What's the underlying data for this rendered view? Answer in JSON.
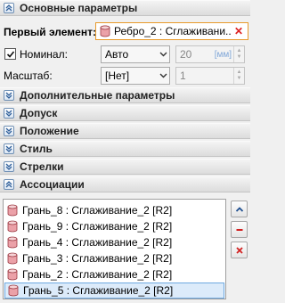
{
  "sections": {
    "main": "Основные параметры",
    "additional": "Дополнительные параметры",
    "tolerance": "Допуск",
    "position": "Положение",
    "style": "Стиль",
    "arrows": "Стрелки",
    "associations": "Ассоциации"
  },
  "first_element": {
    "label": "Первый элемент:",
    "value": "Ребро_2 : Сглаживани..."
  },
  "nominal": {
    "label": "Номинал:",
    "checked": true,
    "mode": "Авто",
    "value": "20",
    "unit": "[мм]"
  },
  "scale": {
    "label": "Масштаб:",
    "mode": "[Нет]",
    "value": "1"
  },
  "associations": {
    "items": [
      "Грань_8 : Сглаживание_2 [R2]",
      "Грань_9 : Сглаживание_2 [R2]",
      "Грань_4 : Сглаживание_2 [R2]",
      "Грань_3 : Сглаживание_2 [R2]",
      "Грань_2 : Сглаживание_2 [R2]",
      "Грань_5 : Сглаживание_2 [R2]"
    ],
    "selected_index": 5
  },
  "icons": {
    "face": "cylinder-icon",
    "expand": "chevron-double-down-icon",
    "collapse": "chevron-double-up-icon",
    "move_up": "chevron-up-icon",
    "remove": "minus-icon",
    "delete": "x-icon"
  },
  "colors": {
    "accent_border": "#e89a2c",
    "selection": "#dcebfa",
    "delete_red": "#d22222"
  }
}
